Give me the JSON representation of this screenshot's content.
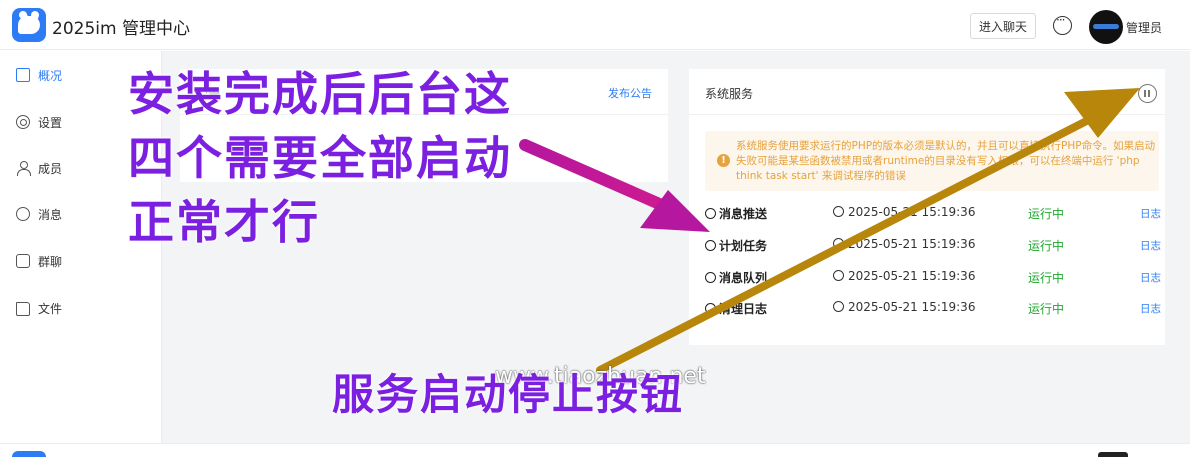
{
  "header": {
    "title": "2025im 管理中心",
    "enter_chat_label": "进入聊天",
    "admin_name": "管理员"
  },
  "sidebar": {
    "items": [
      {
        "label": "概况",
        "icon": "overview-icon",
        "active": true
      },
      {
        "label": "设置",
        "icon": "gear-icon"
      },
      {
        "label": "成员",
        "icon": "user-icon"
      },
      {
        "label": "消息",
        "icon": "chat-bubble-icon"
      },
      {
        "label": "群聊",
        "icon": "group-chat-icon"
      },
      {
        "label": "文件",
        "icon": "folder-icon"
      }
    ]
  },
  "notice_card": {
    "title_partial": "公告",
    "publish_label": "发布公告"
  },
  "service_card": {
    "title": "系统服务",
    "alert_text": "系统服务使用要求运行的PHP的版本必须是默认的，并且可以直接执行PHP命令。如果启动失败可能是某些函数被禁用或者runtime的目录没有写入权限，可以在终端中运行 'php think task start' 来调试程序的错误",
    "services": [
      {
        "name": "消息推送",
        "time": "2025-05-21 15:19:36",
        "status": "运行中",
        "log_label": "日志"
      },
      {
        "name": "计划任务",
        "time": "2025-05-21 15:19:36",
        "status": "运行中",
        "log_label": "日志"
      },
      {
        "name": "消息队列",
        "time": "2025-05-21 15:19:36",
        "status": "运行中",
        "log_label": "日志"
      },
      {
        "name": "清理日志",
        "time": "2025-05-21 15:19:36",
        "status": "运行中",
        "log_label": "日志"
      }
    ]
  },
  "annotations": {
    "line1": "安装完成后后台这",
    "line2": "四个需要全部启动",
    "line3": "正常才行",
    "bottom": "服务启动停止按钮",
    "watermark": "www.tiaozhuan.net"
  },
  "colors": {
    "accent": "#2d7cf6",
    "running": "#22a830",
    "warning": "#e6a23c",
    "annotation": "#7b1fe0",
    "arrow_magenta": "#b5179e",
    "arrow_gold": "#b8860b"
  }
}
